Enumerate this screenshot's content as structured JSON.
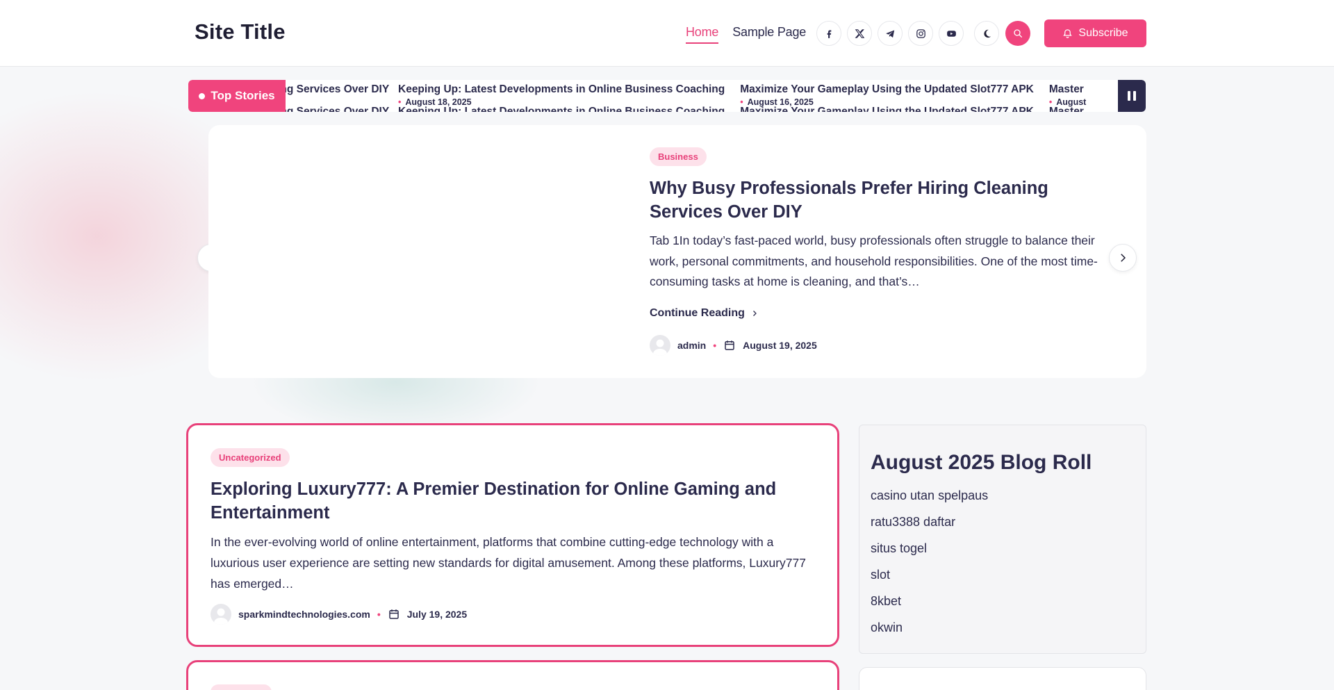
{
  "header": {
    "site_title": "Site Title",
    "nav": [
      {
        "label": "Home",
        "active": true
      },
      {
        "label": "Sample Page",
        "active": false
      }
    ],
    "social_icons": [
      "facebook-icon",
      "x-icon",
      "telegram-icon",
      "instagram-icon",
      "youtube-icon"
    ],
    "subscribe_label": "Subscribe",
    "accent_color": "#f0447d"
  },
  "ticker": {
    "label": "Top Stories",
    "items": [
      {
        "title": "aning Services Over DIY",
        "date": ""
      },
      {
        "title": "Keeping Up: Latest Developments in Online Business Coaching",
        "date": "August 18, 2025"
      },
      {
        "title": "Maximize Your Gameplay Using the Updated Slot777 APK",
        "date": "August 16, 2025"
      },
      {
        "title": "Master",
        "date": "August"
      }
    ]
  },
  "featured": {
    "category": "Business",
    "title": "Why Busy Professionals Prefer Hiring Cleaning Services Over DIY",
    "excerpt": "Tab 1In today’s fast-paced world, busy professionals often struggle to balance their work, personal commitments, and household responsibilities. One of the most time-consuming tasks at home is cleaning, and that’s…",
    "continue_label": "Continue Reading",
    "author": "admin",
    "date": "August 19, 2025"
  },
  "post": {
    "category": "Uncategorized",
    "title": "Exploring Luxury777: A Premier Destination for Online Gaming and Entertainment",
    "excerpt": "In the ever-evolving world of online entertainment, platforms that combine cutting-edge technology with a luxurious user experience are setting new standards for digital amusement. Among these platforms, Luxury777 has emerged…",
    "author": "sparkmindtechnologies.com",
    "date": "July 19, 2025"
  },
  "sidebar": {
    "title": "August 2025 Blog Roll",
    "links": [
      "casino utan spelpaus",
      "ratu3388 daftar",
      "situs togel",
      "slot",
      "8kbet",
      "okwin"
    ]
  }
}
